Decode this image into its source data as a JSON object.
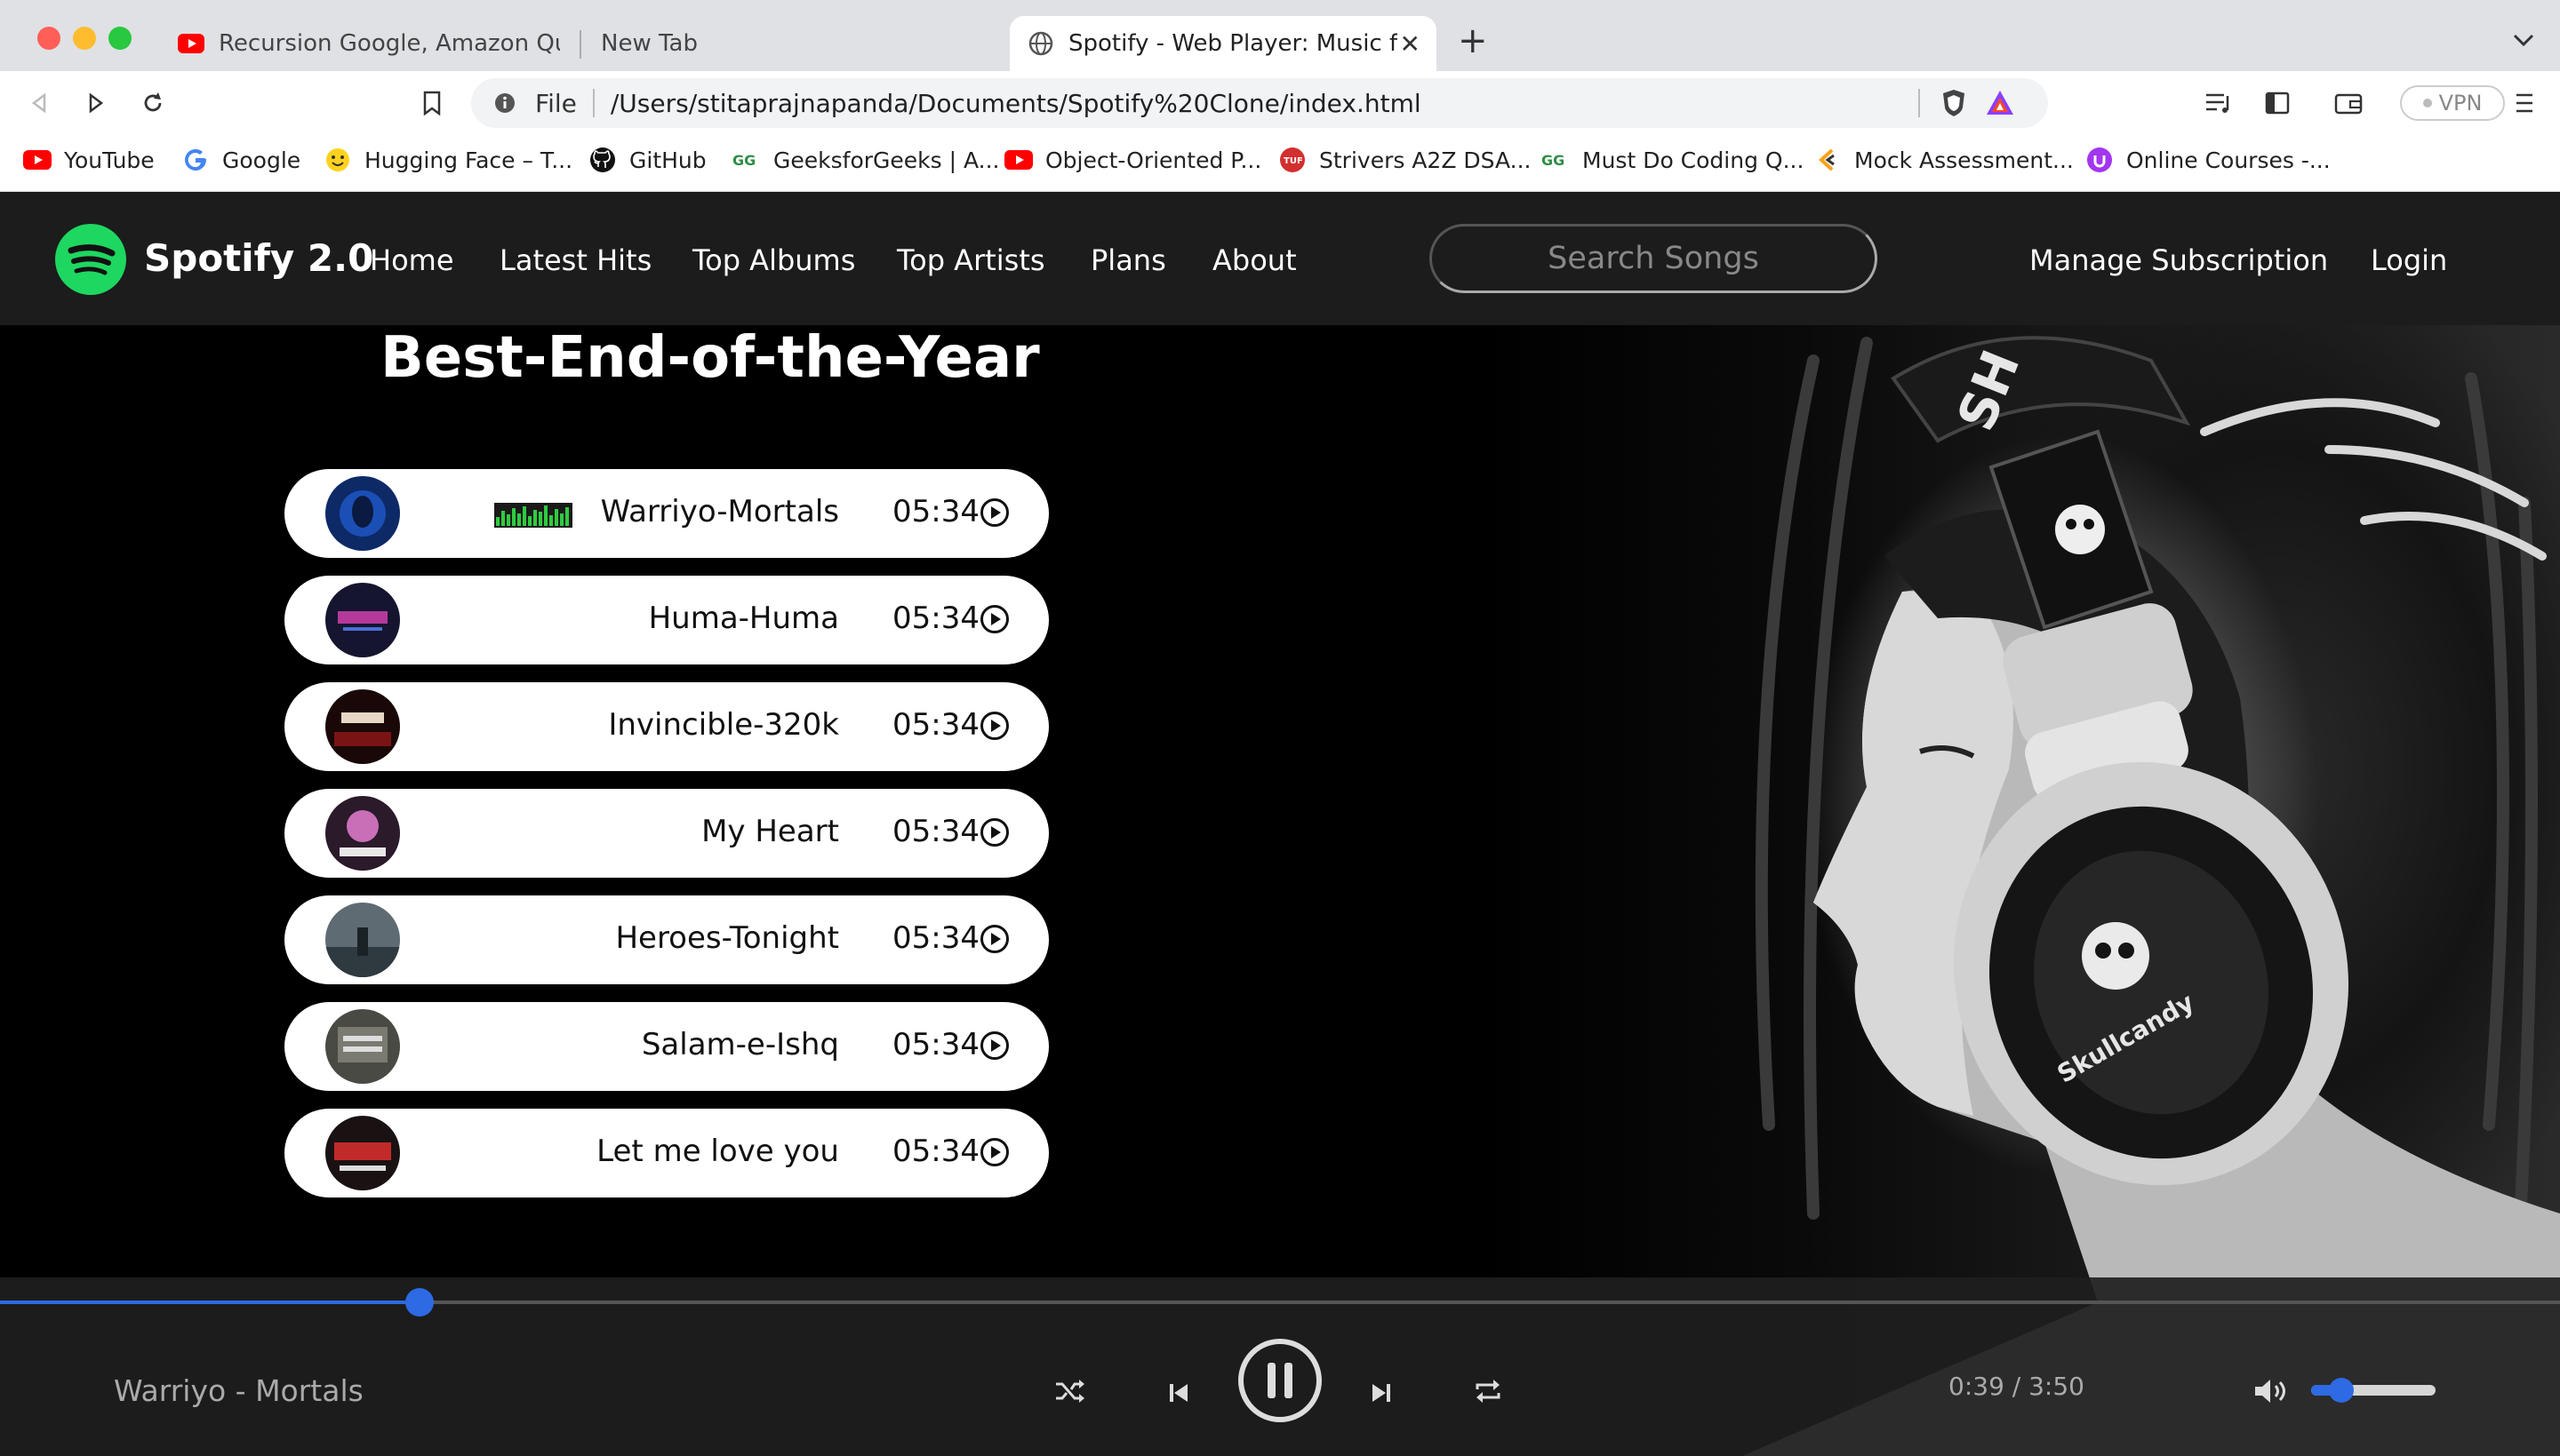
{
  "browser": {
    "tabs": [
      {
        "title": "Recursion Google, Amazon Questio",
        "favicon": "youtube-icon",
        "active": false
      },
      {
        "title": "New Tab",
        "favicon": "none",
        "active": false
      },
      {
        "title": "Spotify - Web Player: Music for",
        "favicon": "globe-icon",
        "active": true
      }
    ],
    "address": {
      "scheme": "File",
      "url": "/Users/stitaprajnapanda/Documents/Spotify%20Clone/index.html"
    },
    "vpn_label": "VPN",
    "bookmarks": [
      {
        "label": "YouTube",
        "icon": "youtube-icon"
      },
      {
        "label": "Google",
        "icon": "google-icon"
      },
      {
        "label": "Hugging Face – T...",
        "icon": "hugging-face-icon"
      },
      {
        "label": "GitHub",
        "icon": "github-icon"
      },
      {
        "label": "GeeksforGeeks | A...",
        "icon": "geeksforgeeks-icon"
      },
      {
        "label": "Object-Oriented P...",
        "icon": "youtube-icon"
      },
      {
        "label": "Strivers A2Z DSA...",
        "icon": "tuf-icon"
      },
      {
        "label": "Must Do Coding Q...",
        "icon": "geeksforgeeks-icon"
      },
      {
        "label": "Mock Assessment...",
        "icon": "codestudio-icon"
      },
      {
        "label": "Online Courses -...",
        "icon": "udemy-icon"
      }
    ]
  },
  "nav": {
    "brand": "Spotify 2.0",
    "links": [
      "Home",
      "Latest Hits",
      "Top Albums",
      "Top Artists",
      "Plans",
      "About"
    ],
    "search_placeholder": "Search Songs",
    "manage": "Manage Subscription",
    "login": "Login"
  },
  "section_title": "Best-End-of-the-Year",
  "songs": [
    {
      "name": "Warriyo-Mortals",
      "duration": "05:34",
      "playing": true
    },
    {
      "name": "Huma-Huma",
      "duration": "05:34",
      "playing": false
    },
    {
      "name": "Invincible-320k",
      "duration": "05:34",
      "playing": false
    },
    {
      "name": "My Heart",
      "duration": "05:34",
      "playing": false
    },
    {
      "name": "Heroes-Tonight",
      "duration": "05:34",
      "playing": false
    },
    {
      "name": "Salam-e-Ishq",
      "duration": "05:34",
      "playing": false
    },
    {
      "name": "Let me love you",
      "duration": "05:34",
      "playing": false
    }
  ],
  "player": {
    "now_playing": "Warriyo - Mortals",
    "time": "0:39 / 3:50",
    "progress_fraction": 0.164,
    "volume_fraction": 0.14,
    "state": "playing"
  },
  "colors": {
    "accent": "#2d6ae3",
    "spotify_green": "#1ed760",
    "nav_bg": "#1c1c1c"
  }
}
